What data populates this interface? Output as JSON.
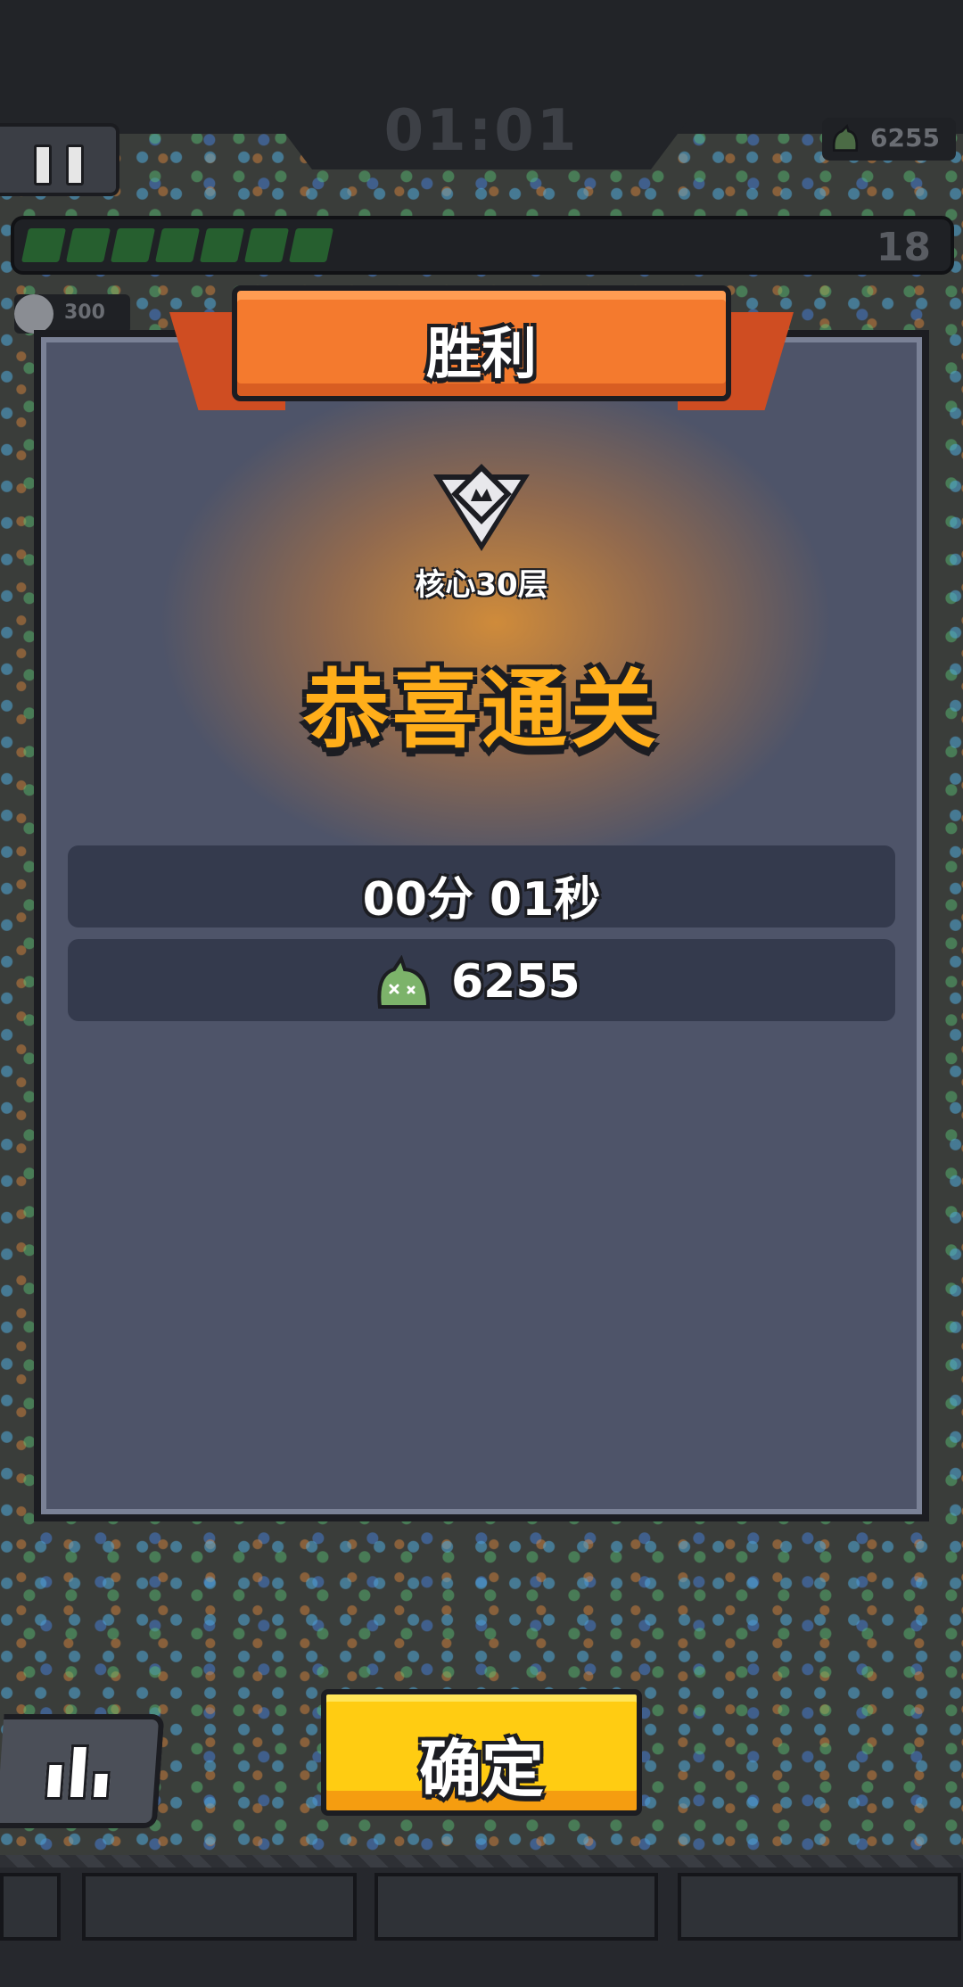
{
  "hud": {
    "timer": "01:01",
    "currency": "6255",
    "level": "18",
    "xp_progress": 0.27,
    "kill_count": "300"
  },
  "dialog": {
    "title": "胜利",
    "stage_name": "核心30层",
    "headline": "恭喜通关",
    "time_result": "00分 01秒",
    "currency_result": "6255"
  },
  "buttons": {
    "confirm_label": "确定"
  },
  "icons": {
    "pause": "pause-icon",
    "rank": "rank-badge-icon",
    "currency": "green-slime-icon",
    "stats": "bar-chart-icon"
  },
  "colors": {
    "headline": "#ffae1a",
    "ribbon": "#f47a2e",
    "confirm": "#ffcc12",
    "panel": "#4e5469",
    "xp_fill": "#265f2f"
  }
}
